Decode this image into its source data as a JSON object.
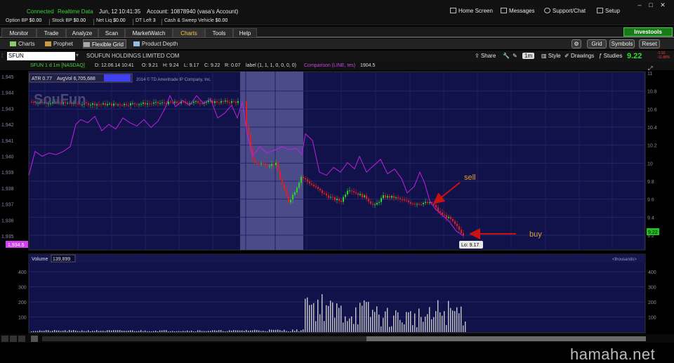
{
  "titlebar": {
    "connected": "Connected",
    "realtime": "Realtime Data",
    "date": "Jun, 12",
    "time": "10:41:35",
    "account_label": "Account:",
    "account": "10878940 (vasa's Account)",
    "home_screen": "Home Screen",
    "messages": "Messages",
    "support": "Support/Chat",
    "setup": "Setup"
  },
  "status": {
    "option_bp_label": "Option BP",
    "option_bp": "$0.00",
    "stock_bp_label": "Stock BP",
    "stock_bp": "$0.00",
    "net_liq_label": "Net Liq",
    "net_liq": "$0.00",
    "dt_left_label": "DT Left",
    "dt_left": "3",
    "cash_label": "Cash & Sweep Vehicle",
    "cash": "$0.00"
  },
  "main_tabs": [
    "Monitor",
    "Trade",
    "Analyze",
    "Scan",
    "MarketWatch",
    "Charts",
    "Tools",
    "Help"
  ],
  "active_tab": "Charts",
  "investools": "Investools",
  "sub_tabs": [
    "Charts",
    "Prophet",
    "Flexible Grid",
    "Product Depth"
  ],
  "active_sub_tab": "Flexible Grid",
  "sub_buttons": {
    "grid": "Grid",
    "symbols": "Symbols",
    "reset": "Reset"
  },
  "symbol": {
    "ticker": "SFUN",
    "name": "SOUFUN HOLDINGS LIMITED COM",
    "share": "Share",
    "interval": "1m",
    "style": "Style",
    "drawings": "Drawings",
    "studies": "Studies",
    "last": "9.22",
    "change_top": "-1.92",
    "change_bottom": "-11.88%"
  },
  "info": {
    "title": "SFUN 1 d 1m [NASDAQ]",
    "date": "D: 12.06.14 10:41",
    "open": "O: 9.21",
    "high": "H: 9.24",
    "low": "L: 9.17",
    "close": "C: 9.22",
    "range": "R: 0.07",
    "label_study": "label (1, 1, 1, 0, 0, 0, 0)",
    "comparison": "Comparison (LINE, tes)",
    "comparison_val": "1904.5"
  },
  "atr": "ATR 0.77",
  "avgvol": "AvgVol 6,705,688",
  "copyright": "2014 © TD Ameritrade IP Company, Inc.",
  "price_axis": [
    "10.8",
    "10.6",
    "10.4",
    "10.2",
    "10",
    "9.8",
    "9.6",
    "9.4",
    "9.2"
  ],
  "price_axis_top": "11",
  "comp_axis": [
    "1,945",
    "1,944",
    "1,943",
    "1,942",
    "1,941",
    "1,940",
    "1,939",
    "1,938",
    "1,937",
    "1,936",
    "1,935"
  ],
  "comp_current": "1,934.5",
  "current_price_tag": "9.22",
  "low_label": "Lo: 9.17",
  "annotations": {
    "sell": "sell",
    "buy": "buy"
  },
  "volume": {
    "label": "Volume",
    "value": "139,899",
    "unit": "<thousands>",
    "axis": [
      "400",
      "300",
      "200",
      "100"
    ]
  },
  "time_axis": [
    "14:30",
    "14:45",
    "15:00",
    "15:15",
    "15:30",
    "15:45",
    "Чт",
    "9:15",
    "9:30",
    "9:45",
    "10:00",
    "10:15",
    "10:30",
    "10:45",
    "11:00",
    "11:15",
    "11:30",
    "11:45",
    "12:00"
  ],
  "watermark": "hamaha.net",
  "colors": {
    "chart_bg": "#12124a",
    "premarket_shade": "#5a5a9a",
    "comparison_line": "#c020e0",
    "up_candle": "#2ed02e",
    "down_candle": "#e02020",
    "volume_bar": "#c8c8c8",
    "arrow": "#cc1111",
    "annotation_text": "#e0a030",
    "axis_text": "#8a8aa8"
  }
}
